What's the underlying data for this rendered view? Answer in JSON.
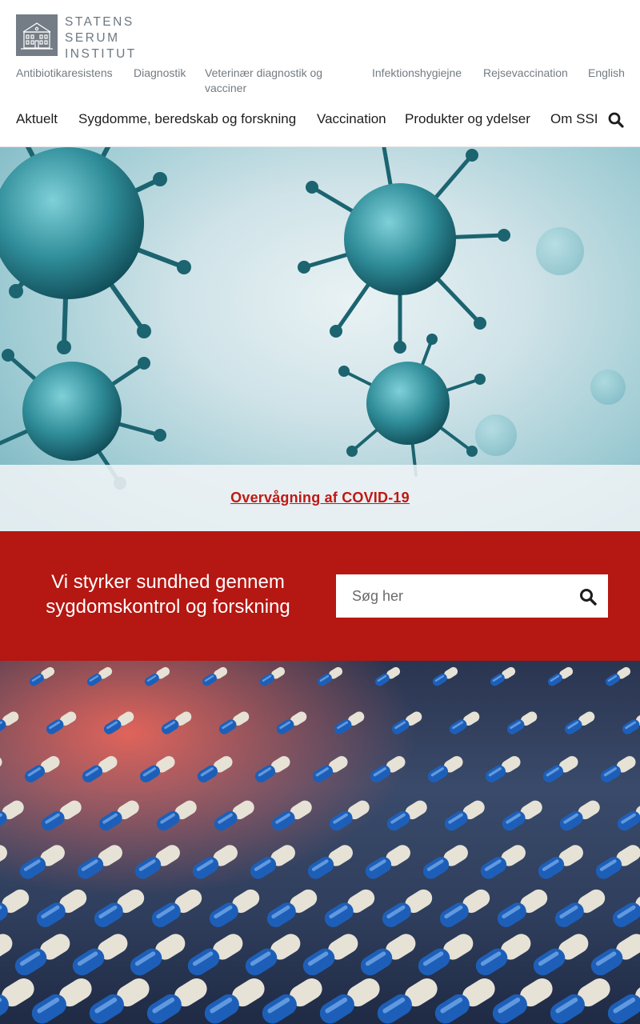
{
  "brand": {
    "logo_lines": [
      "STATENS",
      "SERUM",
      "INSTITUT"
    ]
  },
  "utility_nav": [
    {
      "label": "Antibiotikaresistens"
    },
    {
      "label": "Diagnostik"
    },
    {
      "label": "Veterinær diagnostik og"
    },
    {
      "label": "vacciner"
    },
    {
      "label": "Infektionshygiejne"
    },
    {
      "label": "Rejsevaccination"
    },
    {
      "label": "English"
    }
  ],
  "main_nav": [
    {
      "label": "Aktuelt"
    },
    {
      "label": "Sygdomme, beredskab og forskning"
    },
    {
      "label": "Vaccination"
    },
    {
      "label": "Produkter og ydelser"
    },
    {
      "label": "Om SSI"
    }
  ],
  "icons": {
    "top_search": "search-icon",
    "box_search": "search-icon"
  },
  "hero": {
    "link_label": "Overvågning af COVID-19"
  },
  "banner": {
    "tagline_line1": "Vi styrker sundhed gennem",
    "tagline_line2": "sygdomskontrol og forskning",
    "search_placeholder": "Søg her"
  },
  "colors": {
    "brand_red": "#b51712",
    "link_red": "#c01812",
    "logo_grey": "#747d86"
  }
}
